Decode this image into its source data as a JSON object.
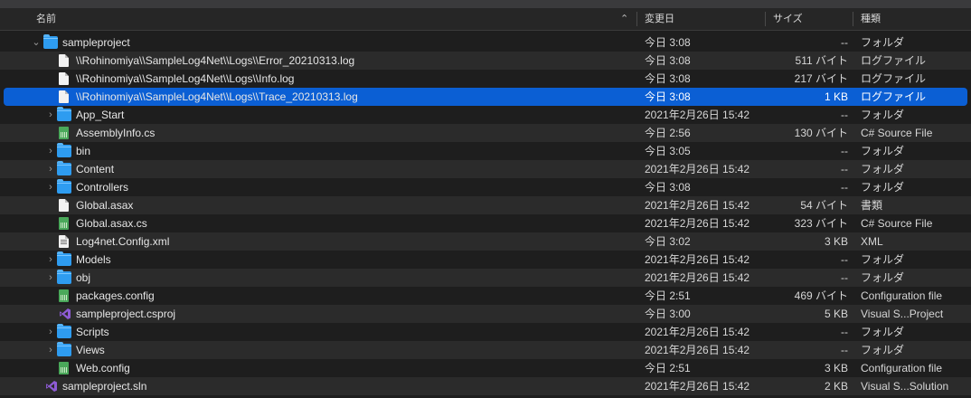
{
  "header": {
    "name_label": "名前",
    "date_label": "変更日",
    "size_label": "サイズ",
    "kind_label": "種類",
    "sort_indicator": "^"
  },
  "rows": [
    {
      "depth": 0,
      "chevron": "v",
      "icon": "folder-icon",
      "name": "sampleproject",
      "date": "今日 3:08",
      "size": "--",
      "kind": "フォルダ"
    },
    {
      "depth": 1,
      "chevron": "",
      "icon": "document-icon",
      "name": "\\\\Rohinomiya\\\\SampleLog4Net\\\\Logs\\\\Error_20210313.log",
      "date": "今日 3:08",
      "size": "511 バイト",
      "kind": "ログファイル"
    },
    {
      "depth": 1,
      "chevron": "",
      "icon": "document-icon",
      "name": "\\\\Rohinomiya\\\\SampleLog4Net\\\\Logs\\\\Info.log",
      "date": "今日 3:08",
      "size": "217 バイト",
      "kind": "ログファイル"
    },
    {
      "depth": 1,
      "chevron": "",
      "icon": "document-icon",
      "name": "\\\\Rohinomiya\\\\SampleLog4Net\\\\Logs\\\\Trace_20210313.log",
      "date": "今日 3:08",
      "size": "1 KB",
      "kind": "ログファイル",
      "selected": true
    },
    {
      "depth": 1,
      "chevron": ">",
      "icon": "folder-icon",
      "name": "App_Start",
      "date": "2021年2月26日 15:42",
      "size": "--",
      "kind": "フォルダ"
    },
    {
      "depth": 1,
      "chevron": "",
      "icon": "csharp-file-icon",
      "name": "AssemblyInfo.cs",
      "date": "今日 2:56",
      "size": "130 バイト",
      "kind": "C# Source File"
    },
    {
      "depth": 1,
      "chevron": ">",
      "icon": "folder-icon",
      "name": "bin",
      "date": "今日 3:05",
      "size": "--",
      "kind": "フォルダ"
    },
    {
      "depth": 1,
      "chevron": ">",
      "icon": "folder-icon",
      "name": "Content",
      "date": "2021年2月26日 15:42",
      "size": "--",
      "kind": "フォルダ"
    },
    {
      "depth": 1,
      "chevron": ">",
      "icon": "folder-icon",
      "name": "Controllers",
      "date": "今日 3:08",
      "size": "--",
      "kind": "フォルダ"
    },
    {
      "depth": 1,
      "chevron": "",
      "icon": "document-icon",
      "name": "Global.asax",
      "date": "2021年2月26日 15:42",
      "size": "54 バイト",
      "kind": "書類"
    },
    {
      "depth": 1,
      "chevron": "",
      "icon": "csharp-file-icon",
      "name": "Global.asax.cs",
      "date": "2021年2月26日 15:42",
      "size": "323 バイト",
      "kind": "C# Source File"
    },
    {
      "depth": 1,
      "chevron": "",
      "icon": "xml-file-icon",
      "name": "Log4net.Config.xml",
      "date": "今日 3:02",
      "size": "3 KB",
      "kind": "XML"
    },
    {
      "depth": 1,
      "chevron": ">",
      "icon": "folder-icon",
      "name": "Models",
      "date": "2021年2月26日 15:42",
      "size": "--",
      "kind": "フォルダ"
    },
    {
      "depth": 1,
      "chevron": ">",
      "icon": "folder-icon",
      "name": "obj",
      "date": "2021年2月26日 15:42",
      "size": "--",
      "kind": "フォルダ"
    },
    {
      "depth": 1,
      "chevron": "",
      "icon": "csharp-file-icon",
      "name": "packages.config",
      "date": "今日 2:51",
      "size": "469 バイト",
      "kind": "Configuration file"
    },
    {
      "depth": 1,
      "chevron": "",
      "icon": "visual-studio-icon",
      "name": "sampleproject.csproj",
      "date": "今日 3:00",
      "size": "5 KB",
      "kind": "Visual S...Project"
    },
    {
      "depth": 1,
      "chevron": ">",
      "icon": "folder-icon",
      "name": "Scripts",
      "date": "2021年2月26日 15:42",
      "size": "--",
      "kind": "フォルダ"
    },
    {
      "depth": 1,
      "chevron": ">",
      "icon": "folder-icon",
      "name": "Views",
      "date": "2021年2月26日 15:42",
      "size": "--",
      "kind": "フォルダ"
    },
    {
      "depth": 1,
      "chevron": "",
      "icon": "csharp-file-icon",
      "name": "Web.config",
      "date": "今日 2:51",
      "size": "3 KB",
      "kind": "Configuration file"
    },
    {
      "depth": 0,
      "chevron": "",
      "icon": "visual-studio-icon",
      "name": "sampleproject.sln",
      "date": "2021年2月26日 15:42",
      "size": "2 KB",
      "kind": "Visual S...Solution"
    }
  ]
}
